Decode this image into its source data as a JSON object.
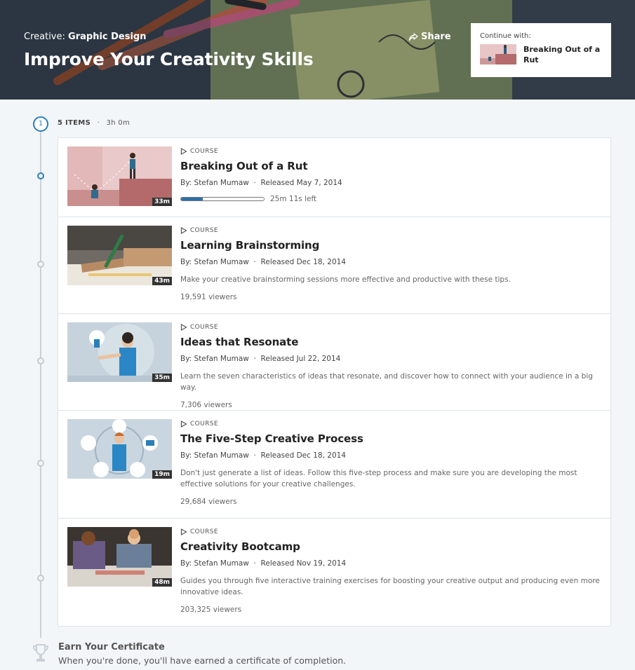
{
  "hero": {
    "category": "Creative:",
    "subcategory": "Graphic Design",
    "title": "Improve Your Creativity Skills",
    "share_label": "Share",
    "continue_label": "Continue with:",
    "continue_title": "Breaking Out of a Rut"
  },
  "path": {
    "step_number": "1",
    "items_label": "5 ITEMS",
    "separator": "·",
    "duration": "3h 0m"
  },
  "courses": [
    {
      "kind": "COURSE",
      "title": "Breaking Out of a Rut",
      "byline": "By: Stefan Mumaw  ·  Released May 7, 2014",
      "duration": "33m",
      "progress": 0.26,
      "progress_label": "25m 11s left"
    },
    {
      "kind": "COURSE",
      "title": "Learning Brainstorming",
      "byline": "By: Stefan Mumaw  ·  Released Dec 18, 2014",
      "duration": "43m",
      "description": "Make your creative brainstorming sessions more effective and productive with these tips.",
      "viewers": "19,591 viewers"
    },
    {
      "kind": "COURSE",
      "title": "Ideas that Resonate",
      "byline": "By: Stefan Mumaw  ·  Released Jul 22, 2014",
      "duration": "35m",
      "description": "Learn the seven characteristics of ideas that resonate, and discover how to connect with your audience in a big way.",
      "viewers": "7,306 viewers"
    },
    {
      "kind": "COURSE",
      "title": "The Five-Step Creative Process",
      "byline": "By: Stefan Mumaw  ·  Released Dec 18, 2014",
      "duration": "19m",
      "description": "Don't just generate a list of ideas. Follow this five-step process and make sure you are developing the most effective solutions for your creative challenges.",
      "viewers": "29,684 viewers"
    },
    {
      "kind": "COURSE",
      "title": "Creativity Bootcamp",
      "byline": "By: Stefan Mumaw  ·  Released Nov 19, 2014",
      "duration": "48m",
      "description": "Guides you through five interactive training exercises for boosting your creative output and producing even more innovative ideas.",
      "viewers": "203,325 viewers"
    }
  ],
  "certificate": {
    "title": "Earn Your Certificate",
    "description": "When you're done, you'll have earned a certificate of completion."
  },
  "icons": {
    "share": "share-arrow-icon",
    "course": "play-triangle-icon",
    "certificate": "trophy-icon"
  },
  "colors": {
    "accent": "#2a7fb8",
    "progress": "#2a6fa8"
  }
}
